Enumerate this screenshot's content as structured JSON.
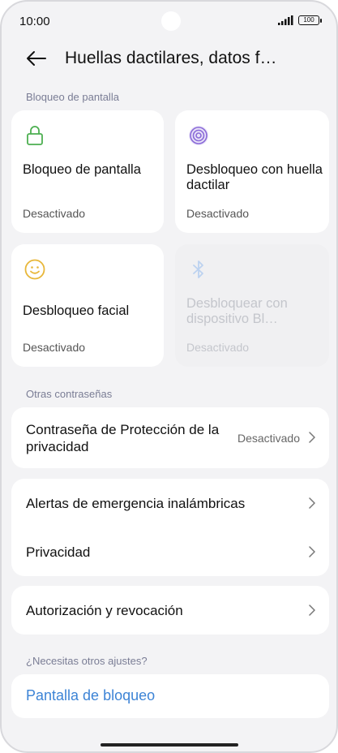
{
  "status_bar": {
    "time": "10:00",
    "battery": "100"
  },
  "header": {
    "title": "Huellas dactilares, datos f…"
  },
  "section_screen_lock": {
    "label": "Bloqueo de pantalla",
    "tiles": [
      {
        "title": "Bloqueo de pantalla",
        "status": "Desactivado",
        "icon": "lock-icon",
        "color": "#4caf50"
      },
      {
        "title": "Desbloqueo con huella dactilar",
        "status": "Desactivado",
        "icon": "fingerprint-icon",
        "color": "#8a6ad8"
      },
      {
        "title": "Desbloqueo facial",
        "status": "Desactivado",
        "icon": "face-icon",
        "color": "#e8b73a"
      },
      {
        "title": "Desbloquear con dispositivo Bl…",
        "status": "Desactivado",
        "icon": "bluetooth-icon",
        "color": "#bcd2f0"
      }
    ]
  },
  "section_other_passwords": {
    "label": "Otras contraseñas",
    "privacy_password": {
      "label": "Contraseña de Protección de la privacidad",
      "value": "Desactivado"
    },
    "rows": [
      {
        "label": "Alertas de emergencia inalámbricas"
      },
      {
        "label": "Privacidad"
      }
    ],
    "authorization": {
      "label": "Autorización y revocación"
    }
  },
  "section_more": {
    "label": "¿Necesitas otros ajustes?",
    "link": "Pantalla de bloqueo"
  }
}
